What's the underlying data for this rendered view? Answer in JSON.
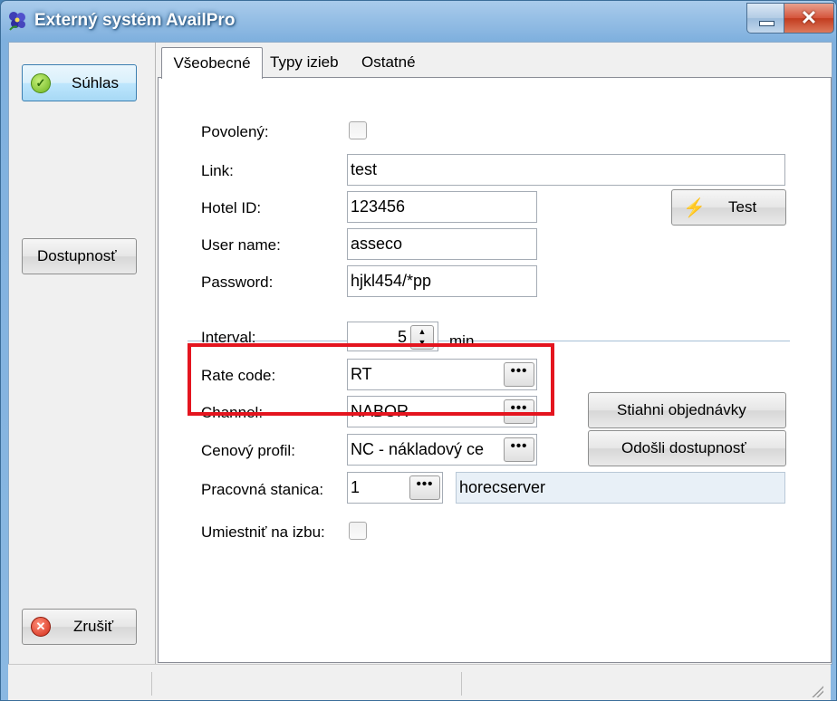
{
  "window": {
    "title": "Externý systém AvailPro",
    "close_glyph": "✕"
  },
  "left_panel": {
    "agree_label": "Súhlas",
    "availability_label": "Dostupnosť",
    "cancel_label": "Zrušiť"
  },
  "tabs": [
    {
      "label": "Všeobecné",
      "active": true
    },
    {
      "label": "Typy izieb",
      "active": false
    },
    {
      "label": "Ostatné",
      "active": false
    }
  ],
  "form": {
    "enabled": {
      "label": "Povolený:",
      "checked": false
    },
    "link": {
      "label": "Link:",
      "value": "test"
    },
    "hotel_id": {
      "label": "Hotel ID:",
      "value": "123456"
    },
    "user_name": {
      "label": "User name:",
      "value": "asseco"
    },
    "password": {
      "label": "Password:",
      "value": "hjkl454/*pp"
    },
    "test_button": "Test",
    "interval": {
      "label": "Interval:",
      "value": "5",
      "unit": "min."
    },
    "rate_code": {
      "label": "Rate code:",
      "value": "RT"
    },
    "channel": {
      "label": "Channel:",
      "value": "NABOR"
    },
    "price_profile": {
      "label": "Cenový profil:",
      "value": "NC - nákladový ce"
    },
    "workstation": {
      "label": "Pracovná stanica:",
      "value": "1",
      "name": "horecserver"
    },
    "place_on_room": {
      "label": "Umiestniť na izbu:",
      "checked": false
    },
    "ellipsis_label": "•••",
    "download_orders_button": "Stiahni objednávky",
    "send_availability_button": "Odošli dostupnosť"
  },
  "colors": {
    "highlight_box": "#e4151f",
    "title_bar": "#7fb0de"
  }
}
